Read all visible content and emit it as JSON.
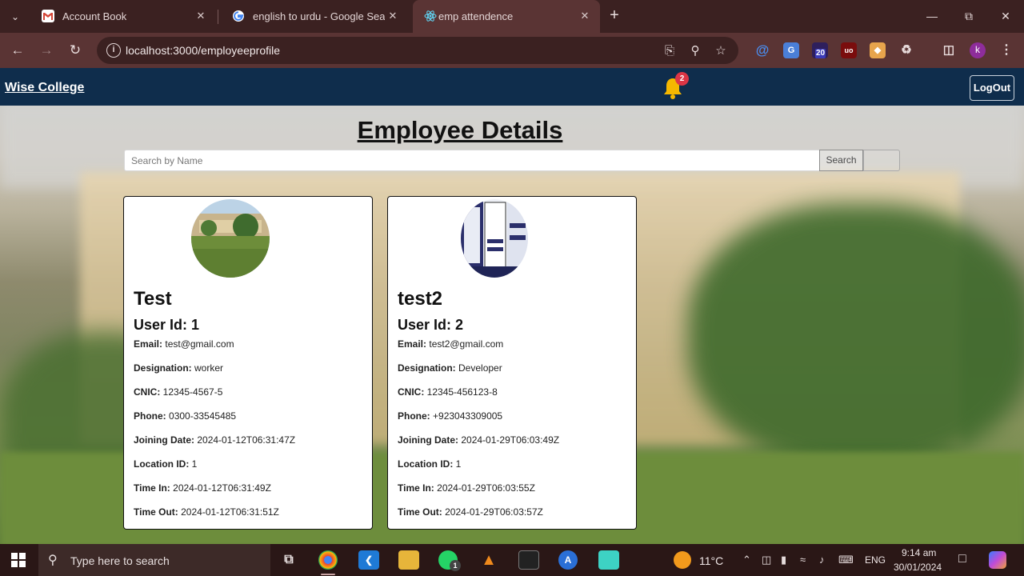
{
  "browser": {
    "tabs": [
      {
        "title": "Account Book",
        "favicon": "gmail-icon"
      },
      {
        "title": "english to urdu - Google Search",
        "favicon": "google-icon"
      },
      {
        "title": "emp attendence",
        "favicon": "react-icon",
        "active": true
      }
    ],
    "url": "localhost:3000/employeeprofile",
    "extension_badge": "20",
    "profile_initial": "k"
  },
  "navbar": {
    "brand": "Wise College",
    "notification_count": "2",
    "logout_label": "LogOut"
  },
  "page": {
    "title": "Employee Details",
    "search_placeholder": "Search by Name",
    "search_button": "Search"
  },
  "labels": {
    "user_id": "User Id:",
    "email": "Email:",
    "designation": "Designation:",
    "cnic": "CNIC:",
    "phone": "Phone:",
    "joining_date": "Joining Date:",
    "location_id": "Location ID:",
    "time_in": "Time In:",
    "time_out": "Time Out:"
  },
  "employees": [
    {
      "name": "Test",
      "user_id": "1",
      "email": "test@gmail.com",
      "designation": "worker",
      "cnic": "12345-4567-5",
      "phone": "0300-33545485",
      "joining_date": "2024-01-12T06:31:47Z",
      "location_id": "1",
      "time_in": "2024-01-12T06:31:49Z",
      "time_out": "2024-01-12T06:31:51Z"
    },
    {
      "name": "test2",
      "user_id": "2",
      "email": "test2@gmail.com",
      "designation": "Developer",
      "cnic": "12345-456123-8",
      "phone": "+923043309005",
      "joining_date": "2024-01-29T06:03:49Z",
      "location_id": "1",
      "time_in": "2024-01-29T06:03:55Z",
      "time_out": "2024-01-29T06:03:57Z"
    }
  ],
  "taskbar": {
    "search_text": "Type here to search",
    "whatsapp_badge": "1",
    "weather": "11°C",
    "language": "ENG",
    "time": "9:14 am",
    "date": "30/01/2024"
  },
  "colors": {
    "navbar": "#0f2d4c",
    "browser_frame": "#3b2121",
    "badge": "#dc3545",
    "bell": "#f5b700"
  }
}
